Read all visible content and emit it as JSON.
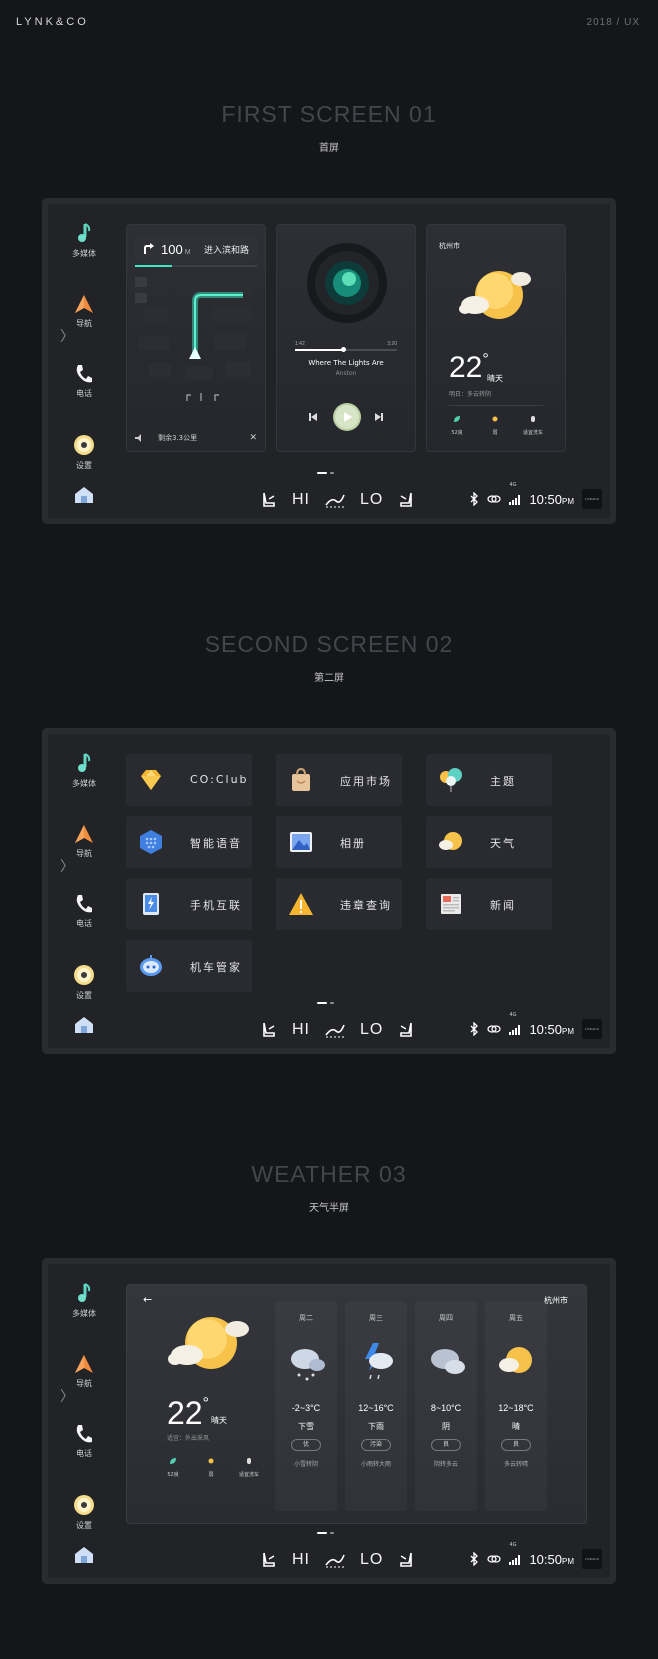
{
  "header": {
    "logo": "LYNK&CO",
    "meta": "2018 / UX"
  },
  "sections": [
    {
      "title": "FIRST SCREEN 01",
      "subtitle": "首屏"
    },
    {
      "title": "SECOND SCREEN 02",
      "subtitle": "第二屏"
    },
    {
      "title": "WEATHER 03",
      "subtitle": "天气半屏"
    }
  ],
  "sidebar": {
    "media": "多媒体",
    "nav": "导航",
    "phone": "电话",
    "settings": "设置",
    "chevron": "〉"
  },
  "climate": {
    "hi": "HI",
    "lo": "LO"
  },
  "status": {
    "time": "10:50",
    "ampm": "PM",
    "network": "4G",
    "logo": "LYNK&CO"
  },
  "screen1": {
    "nav": {
      "distance": "100",
      "unit": "M",
      "road": "进入滨和路",
      "progress": 0.3,
      "remaining": "剩余3.3公里",
      "close": "✕"
    },
    "music": {
      "title": "Where The Lights Are",
      "artist": "Anston",
      "elapsed": "1:42",
      "total": "3:20",
      "progress": 0.47
    },
    "weather": {
      "city": "杭州市",
      "temp": "22",
      "cond": "晴天",
      "tomorrow": "明日：多云转阴",
      "items": [
        "52良",
        "弱",
        "适宜洗车"
      ]
    }
  },
  "screen2": {
    "tiles": [
      {
        "label": "CO:Club",
        "icon": "diamond-icon",
        "color": "#f5b52e"
      },
      {
        "label": "应用市场",
        "icon": "shopping-bag-icon",
        "color": "#e8c49a"
      },
      {
        "label": "主题",
        "icon": "balloon-icon",
        "color": "#5fd0c4"
      },
      {
        "label": "智能语音",
        "icon": "voice-hex-icon",
        "color": "#3f7fe0"
      },
      {
        "label": "相册",
        "icon": "photo-icon",
        "color": "#7aa6f0"
      },
      {
        "label": "天气",
        "icon": "sun-cloud-icon",
        "color": "#f7c24a"
      },
      {
        "label": "手机互联",
        "icon": "phone-link-icon",
        "color": "#4a8be8"
      },
      {
        "label": "违章查询",
        "icon": "warning-icon",
        "color": "#f5b52e"
      },
      {
        "label": "新闻",
        "icon": "news-icon",
        "color": "#eaeaea"
      },
      {
        "label": "机车管家",
        "icon": "robot-icon",
        "color": "#5a9bf0"
      }
    ]
  },
  "screen3": {
    "city": "杭州市",
    "back": "←",
    "temp": "22",
    "cond": "晴天",
    "tip": "适宜：外出采风",
    "items": [
      "52良",
      "弱",
      "适宜洗车"
    ],
    "days": [
      {
        "day": "周二",
        "range": "-2~3°C",
        "cond": "下雪",
        "aq": "优",
        "note": "小雪转阴",
        "icon": "snow-cloud-icon"
      },
      {
        "day": "周三",
        "range": "12~16°C",
        "cond": "下雨",
        "aq": "污染",
        "note": "小雨转大雨",
        "icon": "thunder-rain-icon"
      },
      {
        "day": "周四",
        "range": "8~10°C",
        "cond": "阴",
        "aq": "良",
        "note": "阴转多云",
        "icon": "overcast-icon"
      },
      {
        "day": "周五",
        "range": "12~18°C",
        "cond": "晴",
        "aq": "良",
        "note": "多云转晴",
        "icon": "sun-cloud-icon"
      }
    ]
  }
}
